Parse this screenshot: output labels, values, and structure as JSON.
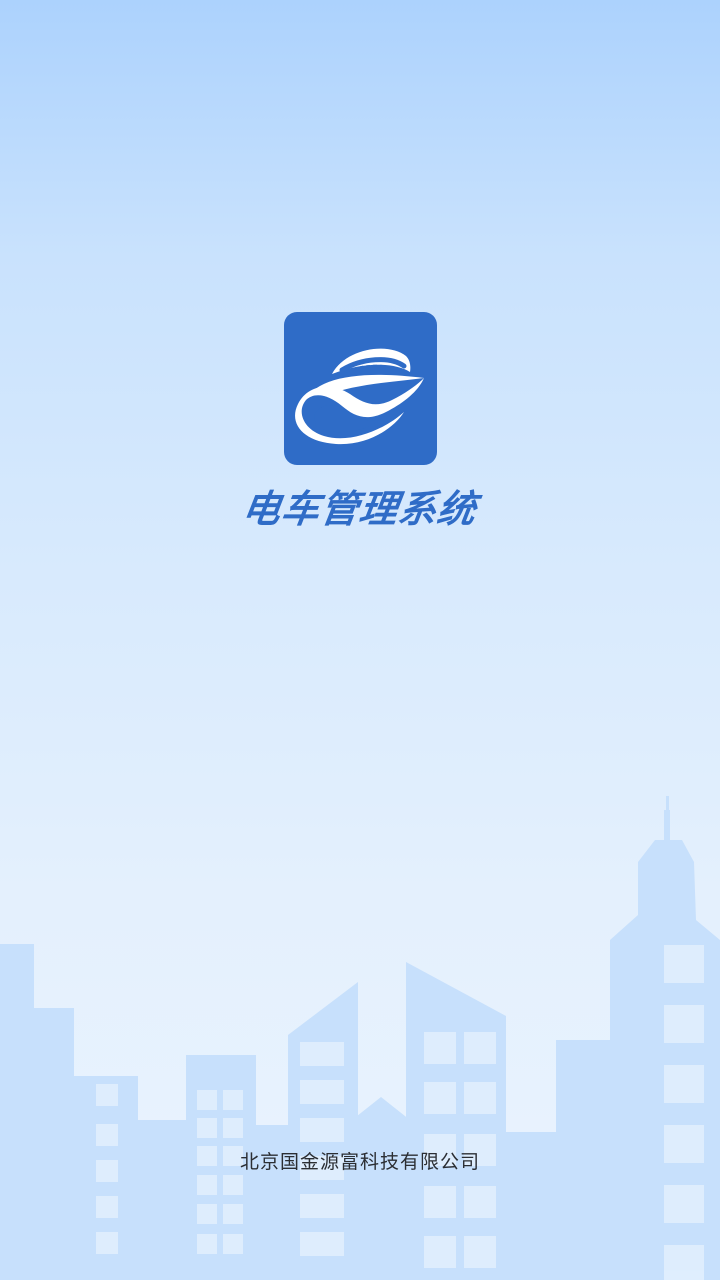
{
  "app": {
    "title": "电车管理系统",
    "logo_icon": "electric-car-logo-icon",
    "brand_color": "#2f6cc7"
  },
  "footer": {
    "company": "北京国金源富科技有限公司"
  },
  "background": {
    "sky_top": "#acd2fd",
    "sky_bottom": "#eaf4fe",
    "building_color": "#c7e0fc",
    "window_color": "#e3f0fe"
  }
}
